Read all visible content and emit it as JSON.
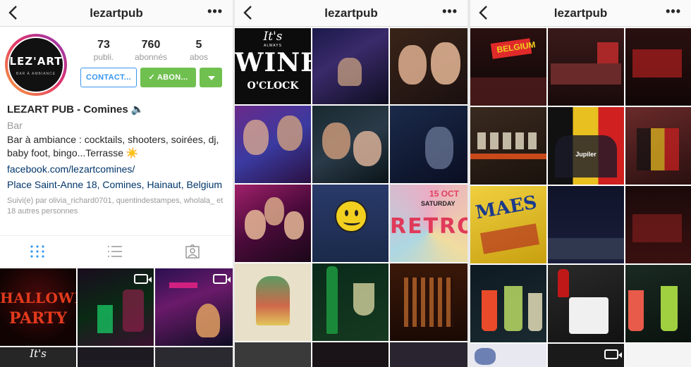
{
  "screens": [
    {
      "title": "lezartpub"
    },
    {
      "title": "lezartpub"
    },
    {
      "title": "lezartpub"
    }
  ],
  "profile": {
    "avatar_logo": "LEZ'ART",
    "avatar_sub": "BAR À AMBIANCE",
    "stats": [
      {
        "num": "73",
        "label": "publi."
      },
      {
        "num": "760",
        "label": "abonnés"
      },
      {
        "num": "5",
        "label": "abos"
      }
    ],
    "contact_label": "CONTACT...",
    "follow_label": "✓ ABON...",
    "name": "LEZART PUB - Comines 🔈",
    "category": "Bar",
    "description": "Bar à ambiance : cocktails, shooters, soirées, dj, baby foot, bingo...Terrasse ☀️",
    "link": "facebook.com/lezartcomines/",
    "address": "Place Saint-Anne 18, Comines, Hainaut, Belgium",
    "followed_by": "Suivi(e) par olivia_richard0701, quentindestampes, wholala_ et 18 autres personnes"
  },
  "posts": {
    "halloween_line1": "HALLOWEEN",
    "halloween_line2": "PARTY",
    "wine_top": "It's",
    "wine_always": "ALWAYS",
    "wine_main": "WINE",
    "wine_clock": "O'CLOCK",
    "retro_date": "15 OCT",
    "retro_day": "SATURDAY",
    "retro_main": "RETRO",
    "belgium_sign": "BELGIUM",
    "jupiler": "Jupiler",
    "maes": "MAES",
    "its_small": "It's"
  },
  "colors": {
    "follow_green": "#70c050",
    "contact_blue": "#3897f0",
    "link_navy": "#003569"
  }
}
